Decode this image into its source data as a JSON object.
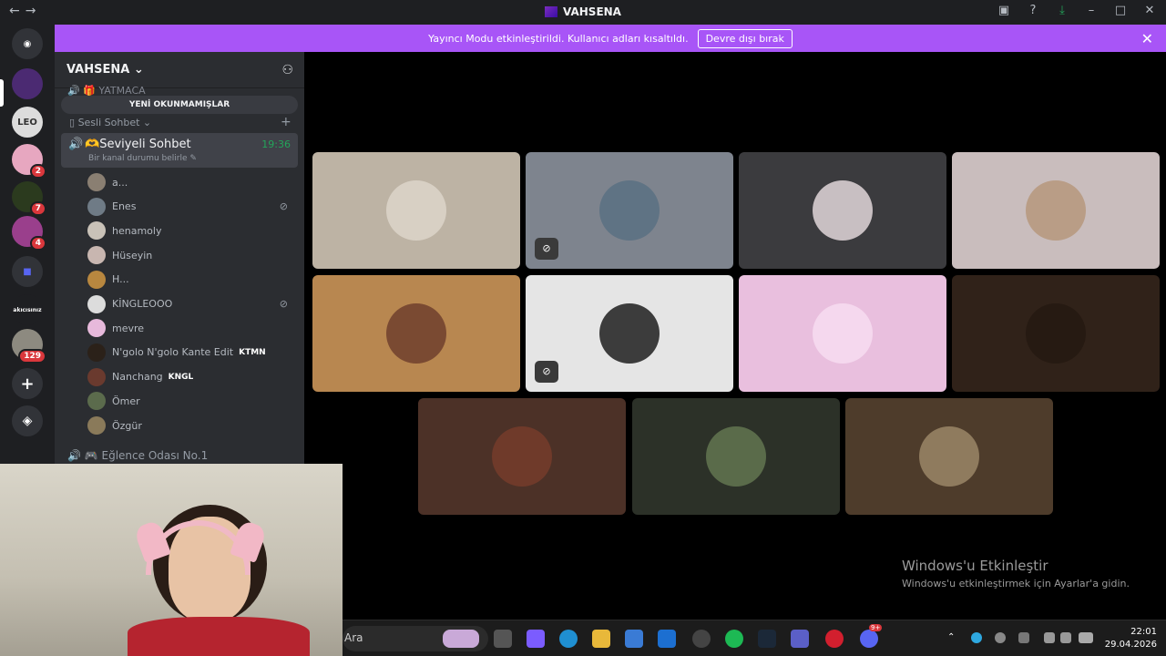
{
  "titlebar": {
    "title": "VAHSENA",
    "back": "←",
    "forward": "→"
  },
  "banner": {
    "text": "Yayıncı Modu etkinleştirildi. Kullanıcı adları kısaltıldı.",
    "button": "Devre dışı bırak",
    "close": "✕"
  },
  "guilds": {
    "badges": [
      "2",
      "7",
      "4",
      "129"
    ],
    "label": "akıcısınız"
  },
  "server": {
    "name": "VAHSENA",
    "chevron": "⌄",
    "partial_channel": "YATMACA",
    "unread": "YENİ OKUNMAMIŞLAR",
    "category": "Sesli Sohbet",
    "active_channel": {
      "name": "Seviyeli Sohbet",
      "emoji": "🫶",
      "time": "19:36",
      "status": "Bir kanal durumu belirle"
    },
    "next_channel": "Eğlence Odası No.1"
  },
  "users": [
    {
      "name": "a...",
      "muted": false,
      "tag": "",
      "color": "#8a7f72"
    },
    {
      "name": "Enes",
      "muted": true,
      "tag": "",
      "color": "#6f7b86"
    },
    {
      "name": "henamoly",
      "muted": false,
      "tag": "",
      "color": "#c9c2b8"
    },
    {
      "name": "Hüseyin",
      "muted": false,
      "tag": "",
      "color": "#c8b6b0"
    },
    {
      "name": "H...",
      "muted": false,
      "tag": "",
      "color": "#b8873f"
    },
    {
      "name": "KİNGLEOOO",
      "muted": true,
      "tag": "",
      "color": "#dcdcdc"
    },
    {
      "name": "mevre",
      "muted": false,
      "tag": "",
      "color": "#e7b9db"
    },
    {
      "name": "N'golo N'golo Kante Edit",
      "muted": false,
      "tag": "KTMN",
      "color": "#2b2119"
    },
    {
      "name": "Nanchang",
      "muted": false,
      "tag": "KNGL",
      "color": "#6a3a2e"
    },
    {
      "name": "Ömer",
      "muted": false,
      "tag": "",
      "color": "#5b6b4c"
    },
    {
      "name": "Özgür",
      "muted": false,
      "tag": "",
      "color": "#8a7a5a"
    }
  ],
  "tiles": [
    {
      "bg": "#bdb3a4",
      "av": "#d8d0c4",
      "muted": false
    },
    {
      "bg": "#7e848e",
      "av": "#5f7384",
      "muted": true
    },
    {
      "bg": "#3b3b3e",
      "av": "#c8bfc2",
      "muted": false
    },
    {
      "bg": "#c9bdbd",
      "av": "#b99d86",
      "muted": false
    },
    {
      "bg": "#b88750",
      "av": "#7a4a32",
      "muted": false
    },
    {
      "bg": "#e5e5e5",
      "av": "#3c3c3c",
      "muted": true
    },
    {
      "bg": "#e9bfde",
      "av": "#f5d8ee",
      "muted": false
    },
    {
      "bg": "#302219",
      "av": "#261a12",
      "muted": false
    },
    {
      "bg": "#4c3127",
      "av": "#6f3a2a",
      "muted": false
    },
    {
      "bg": "#2c3128",
      "av": "#5a6b4a",
      "muted": false
    },
    {
      "bg": "#4e3c2b",
      "av": "#8f7b5e",
      "muted": false
    }
  ],
  "watermark": {
    "title": "Windows'u Etkinleştir",
    "sub": "Windows'u etkinleştirmek için Ayarlar'a gidin."
  },
  "taskbar": {
    "search": "Ara",
    "time": "22:01",
    "date": "29.04.2026",
    "discord_badge": "9+"
  }
}
